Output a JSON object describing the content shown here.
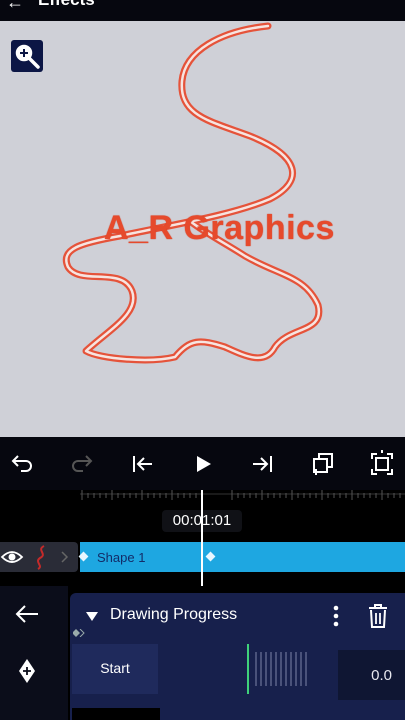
{
  "header": {
    "title": "Effects",
    "back_icon": "back-arrow-icon"
  },
  "canvas": {
    "text": "A_R Graphics",
    "text_color": "#e64a2c",
    "background": "#cfd0d7",
    "zoom_icon": "zoom-magnifier-icon"
  },
  "toolbar": {
    "icons": [
      "undo-icon",
      "redo-icon",
      "skip-to-start-icon",
      "play-icon",
      "skip-to-end-icon",
      "duplicate-add-icon",
      "fullscreen-icon"
    ]
  },
  "timeline": {
    "current_time": "00:01:01",
    "clip_label": "Shape 1",
    "clip_color": "#1ea7e1"
  },
  "effect_panel": {
    "title": "Drawing Progress",
    "param_label": "Start",
    "param_value": "0.0",
    "accent": "#3fd17a"
  }
}
